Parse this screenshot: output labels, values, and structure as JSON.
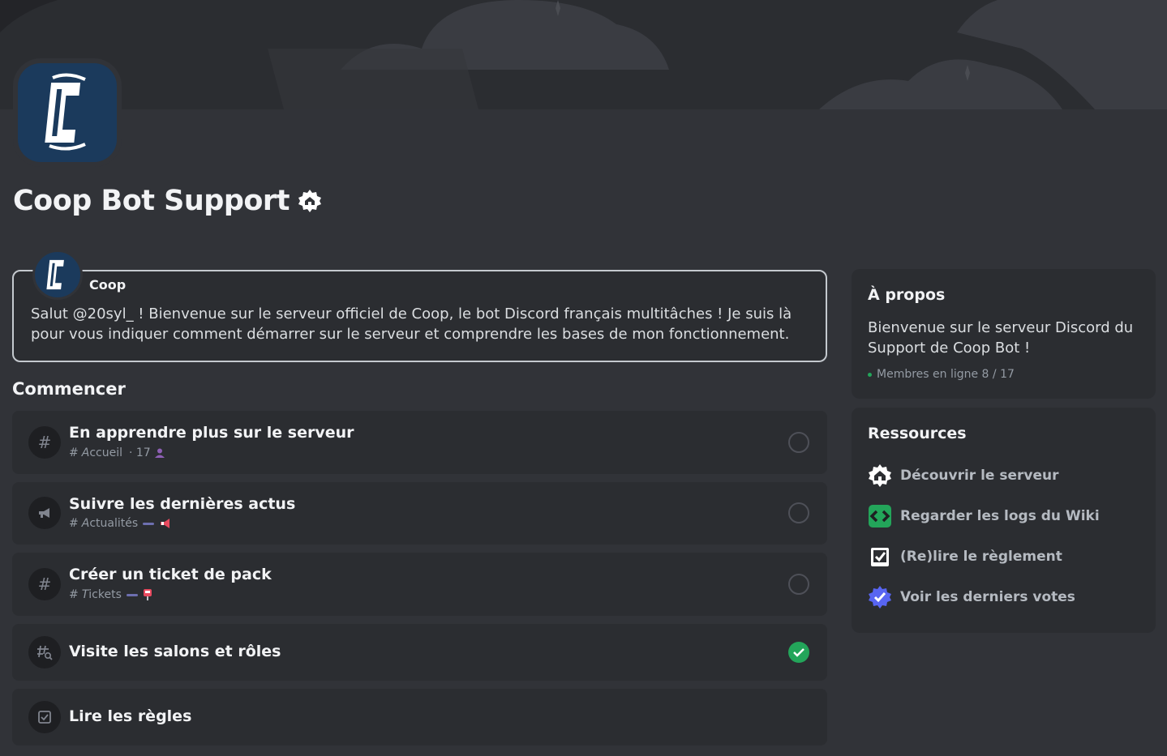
{
  "server": {
    "name": "Coop Bot Support"
  },
  "welcome": {
    "bot_name": "Coop",
    "message": "Salut @20syl_ ! Bienvenue sur le serveur officiel de Coop, le bot Discord français multitâches ! Je suis là pour vous indiquer comment démarrer sur le serveur et comprendre les bases de mon fonctionnement."
  },
  "getting_started": {
    "title": "Commencer",
    "tasks": [
      {
        "title": "En apprendre plus sur le serveur",
        "channel_prefix": "#",
        "channel_letter": "A",
        "channel_rest": "ccueil",
        "extra": "· 17",
        "icon": "hash-icon",
        "done": false
      },
      {
        "title": "Suivre les dernières actus",
        "channel_prefix": "#",
        "channel_letter": "A",
        "channel_rest": "ctualités",
        "extra": "",
        "icon": "megaphone-icon",
        "done": false
      },
      {
        "title": "Créer un ticket de pack",
        "channel_prefix": "#",
        "channel_letter": "T",
        "channel_rest": "ickets",
        "extra": "",
        "icon": "hash-icon",
        "done": false
      },
      {
        "title": "Visite les salons et rôles",
        "icon": "channel-browse-icon",
        "done": true
      },
      {
        "title": "Lire les règles",
        "icon": "rules-icon",
        "done": false
      }
    ]
  },
  "about": {
    "title": "À propos",
    "description": "Bienvenue sur le serveur Discord du Support de Coop Bot !",
    "online_label": "Membres en ligne 8 / 17"
  },
  "resources": {
    "title": "Ressources",
    "items": [
      {
        "label": "Découvrir le serveur",
        "icon": "home-badge-icon"
      },
      {
        "label": "Regarder les logs du Wiki",
        "icon": "code-icon"
      },
      {
        "label": "(Re)lire le règlement",
        "icon": "checklist-icon"
      },
      {
        "label": "Voir les derniers votes",
        "icon": "verified-badge-icon"
      }
    ]
  },
  "colors": {
    "background": "#313338",
    "card": "#2b2d31",
    "accent_green": "#23a55a",
    "blurple": "#5865f2"
  }
}
